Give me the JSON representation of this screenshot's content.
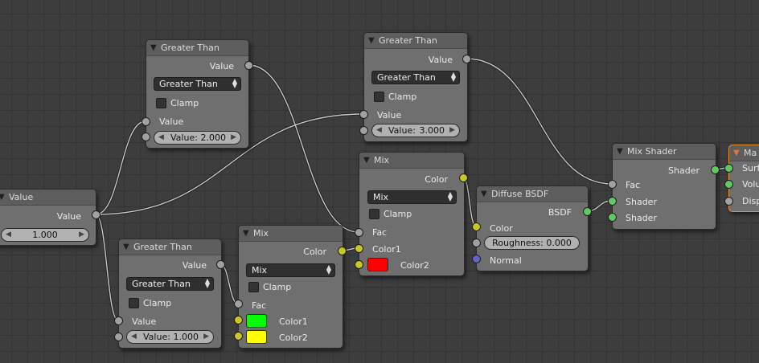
{
  "colors": {
    "value_socket": "#a1a1a1",
    "color_socket": "#c7c729",
    "shader_socket": "#63c763",
    "vector_socket": "#6363c7",
    "color1_green": "#00ff00",
    "color2_yellow": "#ffff00",
    "color2_red": "#ff0000",
    "output_accent": "#e8912f"
  },
  "nodes": {
    "value": {
      "title": "Value",
      "out_label": "Value",
      "field_value": "1.000"
    },
    "gt1": {
      "title": "Greater Than",
      "out_label": "Value",
      "op": "Greater Than",
      "clamp": "Clamp",
      "in_label": "Value",
      "field_label": "Value:",
      "field_value": "2.000"
    },
    "gt2": {
      "title": "Greater Than",
      "out_label": "Value",
      "op": "Greater Than",
      "clamp": "Clamp",
      "in_label": "Value",
      "field_label": "Value:",
      "field_value": "3.000"
    },
    "gt3": {
      "title": "Greater Than",
      "out_label": "Value",
      "op": "Greater Than",
      "clamp": "Clamp",
      "in_label": "Value",
      "field_label": "Value:",
      "field_value": "1.000"
    },
    "mix1": {
      "title": "Mix",
      "out_label": "Color",
      "op": "Mix",
      "clamp": "Clamp",
      "fac": "Fac",
      "color1": "Color1",
      "color2": "Color2"
    },
    "mix2": {
      "title": "Mix",
      "out_label": "Color",
      "op": "Mix",
      "clamp": "Clamp",
      "fac": "Fac",
      "color1": "Color1",
      "color2": "Color2"
    },
    "diffuse": {
      "title": "Diffuse BSDF",
      "out_label": "BSDF",
      "color": "Color",
      "roughness": "Roughness: 0.000",
      "normal": "Normal"
    },
    "mixshader": {
      "title": "Mix Shader",
      "out_label": "Shader",
      "fac": "Fac",
      "shader1": "Shader",
      "shader2": "Shader"
    },
    "output": {
      "title": "Ma",
      "surface": "Surfa",
      "volume": "Volu",
      "displacement": "Disp"
    }
  }
}
